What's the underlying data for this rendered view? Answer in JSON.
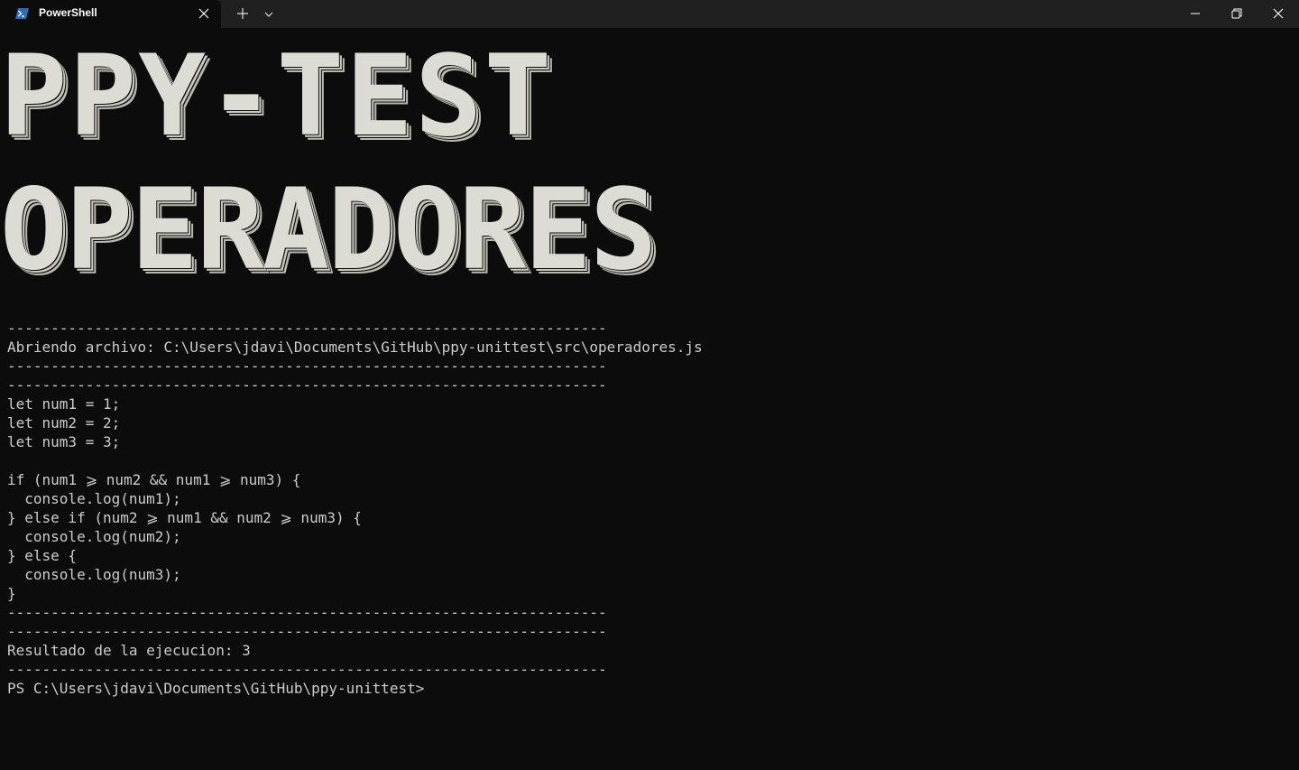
{
  "window": {
    "tab_title": "PowerShell"
  },
  "icons": {
    "tab": "powershell-icon",
    "close_tab": "close-icon",
    "new_tab": "plus-icon",
    "dropdown": "chevron-down-icon",
    "minimize": "minimize-icon",
    "maximize": "restore-icon",
    "close_window": "close-icon"
  },
  "colors": {
    "background": "#0c0c0c",
    "titlebar": "#202020",
    "text": "#cccccc",
    "banner": "#dcdcd4"
  },
  "banner": {
    "line1": "PPY-TEST",
    "line2": "OPERADORES"
  },
  "terminal": {
    "lines": [
      "---------------------------------------------------------------------",
      "Abriendo archivo: C:\\Users\\jdavi\\Documents\\GitHub\\ppy-unittest\\src\\operadores.js",
      "---------------------------------------------------------------------",
      "---------------------------------------------------------------------",
      "let num1 = 1;",
      "let num2 = 2;",
      "let num3 = 3;",
      "",
      "if (num1 ⩾ num2 && num1 ⩾ num3) {",
      "  console.log(num1);",
      "} else if (num2 ⩾ num1 && num2 ⩾ num3) {",
      "  console.log(num2);",
      "} else {",
      "  console.log(num3);",
      "}",
      "---------------------------------------------------------------------",
      "---------------------------------------------------------------------",
      "Resultado de la ejecucion: 3",
      "---------------------------------------------------------------------",
      "PS C:\\Users\\jdavi\\Documents\\GitHub\\ppy-unittest>"
    ]
  }
}
